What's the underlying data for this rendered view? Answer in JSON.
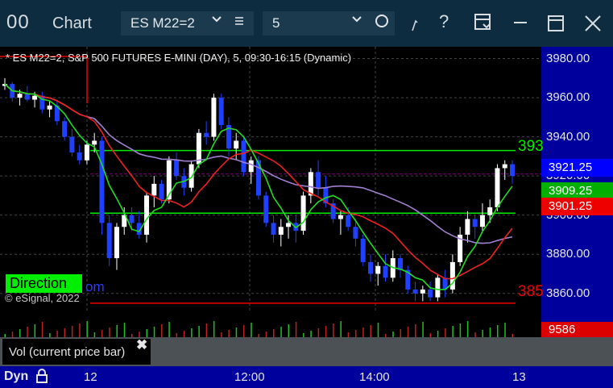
{
  "window": {
    "icon": "00",
    "title": "Chart"
  },
  "toolbar": {
    "symbol": "ES M22=2",
    "interval": "5",
    "icons": [
      "chevron-down-icon",
      "menu-icon",
      "chevron-down-icon",
      "clock-icon",
      "pin-icon",
      "help-icon",
      "template-icon",
      "maximize-icon",
      "close-icon"
    ],
    "help": "?"
  },
  "chart_header": "* ES M22=2, S&P 500 FUTURES E-MINI (DAY), 5, 09:30-16:15 (Dynamic)",
  "price_axis": {
    "ticks": [
      "3980.00",
      "3960.00",
      "3940.00",
      "3920.00",
      "3900.00",
      "3880.00",
      "3860.00"
    ]
  },
  "price_tags": {
    "last": "3921.25",
    "green": "3909.25",
    "red": "3901.25",
    "last_color": "#0000ff",
    "green_color": "#00b000",
    "red_color": "#ee0000"
  },
  "right_labels": {
    "top": "393",
    "bottom": "385"
  },
  "direction_label": "Direction",
  "direction_suffix": "om",
  "copyright": "© eSignal, 2022",
  "volume": {
    "label": "Vol (current price bar)",
    "value": "9586",
    "value_color": "#dd0000"
  },
  "time_axis": {
    "labels": [
      "12",
      "12:00",
      "14:00",
      "13"
    ]
  },
  "status": {
    "mode": "Dyn"
  },
  "chart_data": {
    "type": "candlestick",
    "ylim": [
      3850,
      3986
    ],
    "levels": {
      "green_upper": 3933,
      "green_lower": 3901,
      "red_lower": 3855
    },
    "candles": [
      [
        3966,
        3970,
        3964,
        3967
      ],
      [
        3967,
        3968,
        3958,
        3960
      ],
      [
        3960,
        3964,
        3956,
        3962
      ],
      [
        3962,
        3966,
        3958,
        3959
      ],
      [
        3959,
        3963,
        3955,
        3961
      ],
      [
        3961,
        3963,
        3952,
        3954
      ],
      [
        3954,
        3958,
        3950,
        3956
      ],
      [
        3956,
        3958,
        3946,
        3948
      ],
      [
        3948,
        3950,
        3938,
        3940
      ],
      [
        3940,
        3944,
        3930,
        3932
      ],
      [
        3932,
        3936,
        3926,
        3928
      ],
      [
        3928,
        3938,
        3926,
        3936
      ],
      [
        3936,
        3942,
        3932,
        3938
      ],
      [
        3938,
        3940,
        3890,
        3896
      ],
      [
        3896,
        3900,
        3874,
        3878
      ],
      [
        3878,
        3896,
        3872,
        3894
      ],
      [
        3894,
        3904,
        3890,
        3900
      ],
      [
        3900,
        3904,
        3892,
        3896
      ],
      [
        3896,
        3902,
        3888,
        3890
      ],
      [
        3890,
        3912,
        3886,
        3910
      ],
      [
        3910,
        3920,
        3904,
        3916
      ],
      [
        3916,
        3918,
        3906,
        3908
      ],
      [
        3908,
        3930,
        3906,
        3928
      ],
      [
        3928,
        3932,
        3918,
        3920
      ],
      [
        3920,
        3924,
        3910,
        3914
      ],
      [
        3914,
        3928,
        3912,
        3926
      ],
      [
        3926,
        3944,
        3924,
        3942
      ],
      [
        3942,
        3948,
        3936,
        3940
      ],
      [
        3940,
        3962,
        3938,
        3960
      ],
      [
        3960,
        3962,
        3944,
        3946
      ],
      [
        3946,
        3950,
        3930,
        3934
      ],
      [
        3934,
        3942,
        3928,
        3938
      ],
      [
        3938,
        3940,
        3920,
        3922
      ],
      [
        3922,
        3930,
        3916,
        3928
      ],
      [
        3928,
        3930,
        3908,
        3910
      ],
      [
        3910,
        3912,
        3894,
        3896
      ],
      [
        3896,
        3900,
        3886,
        3890
      ],
      [
        3890,
        3898,
        3884,
        3894
      ],
      [
        3894,
        3900,
        3888,
        3896
      ],
      [
        3896,
        3900,
        3886,
        3892
      ],
      [
        3892,
        3912,
        3890,
        3910
      ],
      [
        3910,
        3924,
        3906,
        3922
      ],
      [
        3922,
        3928,
        3910,
        3914
      ],
      [
        3914,
        3920,
        3904,
        3906
      ],
      [
        3906,
        3908,
        3896,
        3898
      ],
      [
        3898,
        3902,
        3890,
        3900
      ],
      [
        3900,
        3904,
        3892,
        3894
      ],
      [
        3894,
        3898,
        3884,
        3888
      ],
      [
        3888,
        3890,
        3874,
        3876
      ],
      [
        3876,
        3880,
        3866,
        3870
      ],
      [
        3870,
        3876,
        3864,
        3874
      ],
      [
        3874,
        3880,
        3866,
        3868
      ],
      [
        3868,
        3882,
        3866,
        3878
      ],
      [
        3878,
        3880,
        3868,
        3872
      ],
      [
        3872,
        3874,
        3860,
        3862
      ],
      [
        3862,
        3866,
        3856,
        3860
      ],
      [
        3860,
        3864,
        3856,
        3862
      ],
      [
        3862,
        3866,
        3856,
        3858
      ],
      [
        3858,
        3870,
        3856,
        3868
      ],
      [
        3868,
        3872,
        3858,
        3862
      ],
      [
        3862,
        3880,
        3860,
        3876
      ],
      [
        3876,
        3894,
        3874,
        3890
      ],
      [
        3890,
        3902,
        3886,
        3898
      ],
      [
        3898,
        3900,
        3888,
        3894
      ],
      [
        3894,
        3906,
        3892,
        3900
      ],
      [
        3900,
        3908,
        3896,
        3904
      ],
      [
        3904,
        3926,
        3902,
        3924
      ],
      [
        3924,
        3928,
        3918,
        3926
      ],
      [
        3926,
        3928,
        3916,
        3920
      ]
    ]
  }
}
